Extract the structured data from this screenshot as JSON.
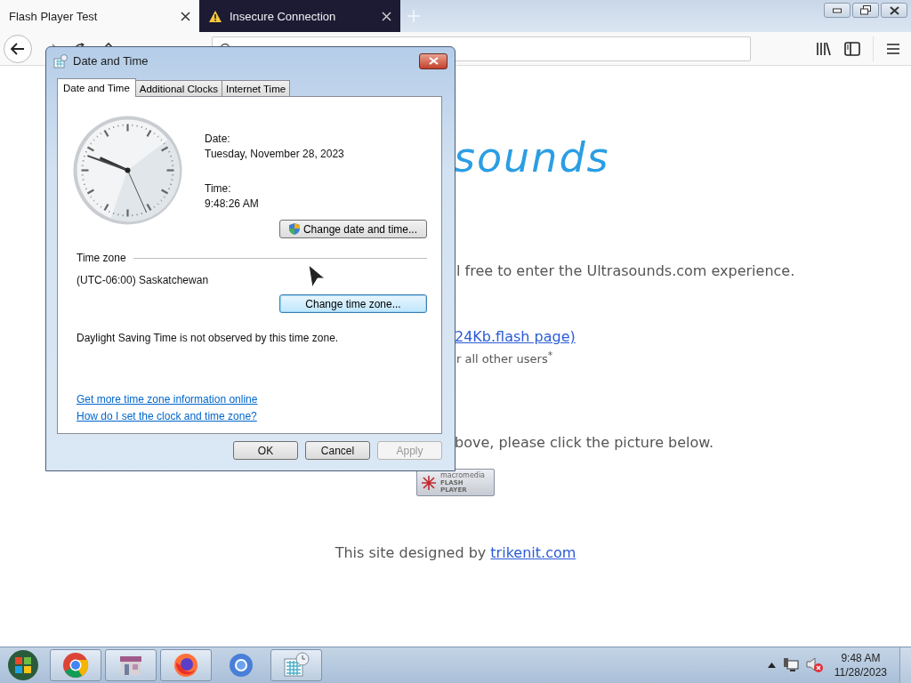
{
  "browser": {
    "tabs": [
      {
        "title": "Flash Player Test",
        "selected": true,
        "insecure": false
      },
      {
        "title": "Insecure Connection",
        "selected": false,
        "insecure": true
      }
    ]
  },
  "page": {
    "logo": "sounds",
    "lines": [
      {
        "kind": "text",
        "text": "l free to enter the Ultrasounds.com experience."
      },
      {
        "kind": "link",
        "text": "24Kb.flash page)"
      },
      {
        "kind": "note",
        "text": "r all other users$^{*}$"
      },
      {
        "kind": "text",
        "text": "bove, please click the picture below."
      }
    ],
    "badge": {
      "brand": "macromedia",
      "product": [
        "FLASH",
        "PLAYER"
      ]
    },
    "footer": {
      "text": "This site designed by",
      "link": "trikenit.com"
    }
  },
  "dialog": {
    "title": "Date and Time",
    "tabs": [
      {
        "label": "Date and Time",
        "selected": true
      },
      {
        "label": "Additional Clocks",
        "selected": false
      },
      {
        "label": "Internet Time",
        "selected": false
      }
    ],
    "date_label": "Date:",
    "date": "Tuesday, November 28, 2023",
    "time_label": "Time:",
    "time": "9:48:26 AM",
    "change_date_button": {
      "label": "Change date and time...",
      "shield": true,
      "focused": false
    },
    "time_zone_heading": "Time zone",
    "time_zone": "(UTC-06:00) Saskatchewan",
    "change_zone_button": {
      "label": "Change time zone...",
      "shield": false,
      "focused": true
    },
    "dst_note": "Daylight Saving Time is not observed by this time zone.",
    "links": [
      "Get more time zone information online",
      "How do I set the clock and time zone?"
    ],
    "buttons": [
      {
        "label": "OK",
        "disabled": false
      },
      {
        "label": "Cancel",
        "disabled": false
      },
      {
        "label": "Apply",
        "disabled": true
      }
    ]
  },
  "taskbar": {
    "items": [
      {
        "kind": "chrome",
        "running": true
      },
      {
        "kind": "app",
        "running": true
      },
      {
        "kind": "firefox",
        "running": true
      },
      {
        "kind": "chromium",
        "running": false
      },
      {
        "kind": "calendar",
        "running": true
      }
    ],
    "tray": {
      "volume_muted": true,
      "time": "9:48 AM",
      "date": "11/28/2023"
    }
  }
}
